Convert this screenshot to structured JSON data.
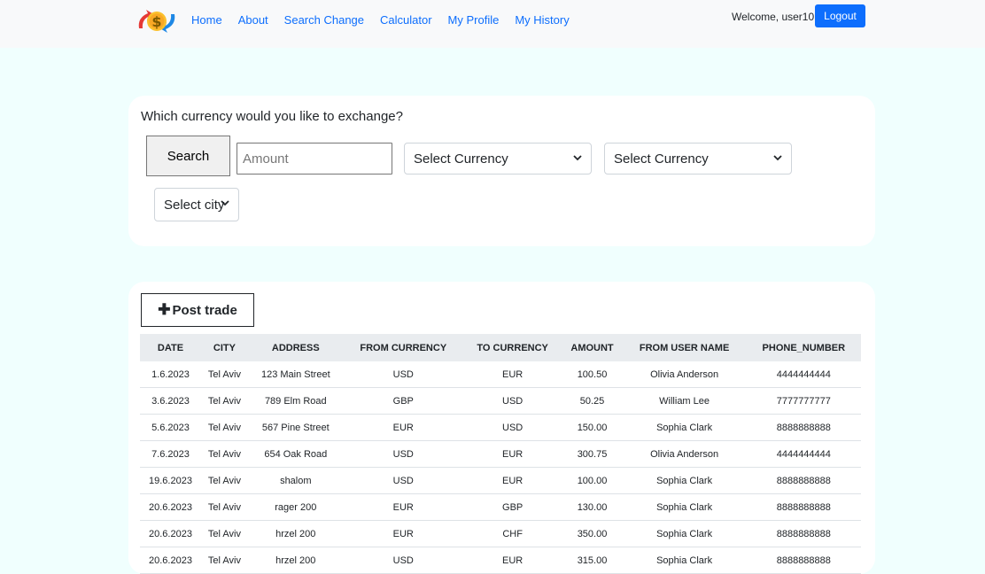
{
  "nav": {
    "links": [
      "Home",
      "About",
      "Search Change",
      "Calculator",
      "My Profile",
      "My History"
    ],
    "welcome": "Welcome, user10!",
    "logout_label": "Logout"
  },
  "search": {
    "title": "Which currency would you like to exchange?",
    "button_label": "Search",
    "amount_placeholder": "Amount",
    "from_currency": "Select Currency",
    "to_currency": "Select Currency",
    "city": "Select city"
  },
  "trades": {
    "post_label": "Post trade",
    "columns": [
      "DATE",
      "CITY",
      "ADDRESS",
      "FROM CURRENCY",
      "TO CURRENCY",
      "AMOUNT",
      "FROM USER NAME",
      "PHONE_NUMBER"
    ],
    "rows": [
      [
        "1.6.2023",
        "Tel Aviv",
        "123 Main Street",
        "USD",
        "EUR",
        "100.50",
        "Olivia Anderson",
        "4444444444"
      ],
      [
        "3.6.2023",
        "Tel Aviv",
        "789 Elm Road",
        "GBP",
        "USD",
        "50.25",
        "William Lee",
        "7777777777"
      ],
      [
        "5.6.2023",
        "Tel Aviv",
        "567 Pine Street",
        "EUR",
        "USD",
        "150.00",
        "Sophia Clark",
        "8888888888"
      ],
      [
        "7.6.2023",
        "Tel Aviv",
        "654 Oak Road",
        "USD",
        "EUR",
        "300.75",
        "Olivia Anderson",
        "4444444444"
      ],
      [
        "19.6.2023",
        "Tel Aviv",
        "shalom",
        "USD",
        "EUR",
        "100.00",
        "Sophia Clark",
        "8888888888"
      ],
      [
        "20.6.2023",
        "Tel Aviv",
        "rager 200",
        "EUR",
        "GBP",
        "130.00",
        "Sophia Clark",
        "8888888888"
      ],
      [
        "20.6.2023",
        "Tel Aviv",
        "hrzel 200",
        "EUR",
        "CHF",
        "350.00",
        "Sophia Clark",
        "8888888888"
      ],
      [
        "20.6.2023",
        "Tel Aviv",
        "hrzel 200",
        "USD",
        "EUR",
        "315.00",
        "Sophia Clark",
        "8888888888"
      ]
    ]
  },
  "colors": {
    "page_bg": "#f0fffe",
    "nav_bg": "#f8f9fa",
    "link": "#0d6efd",
    "logout_bg": "#0d6efd",
    "table_header_bg": "#e9ecef"
  }
}
